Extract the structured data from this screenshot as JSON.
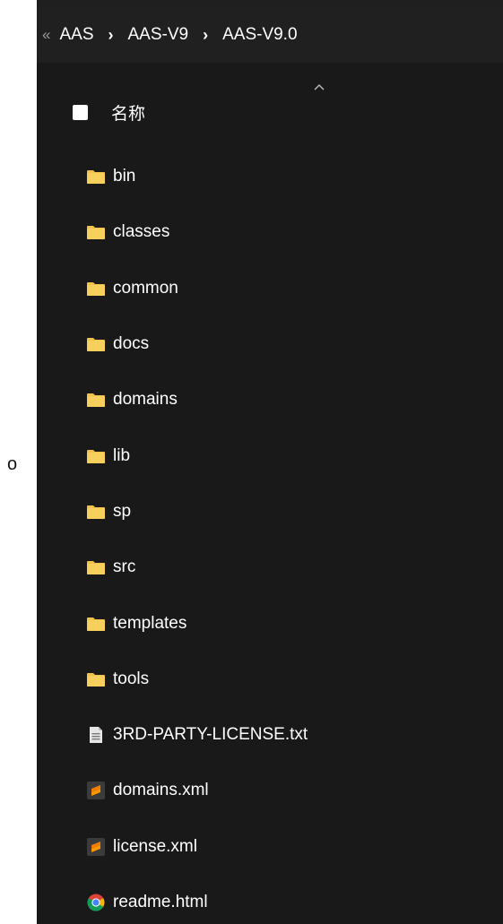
{
  "stray_mark": "o",
  "breadcrumb": {
    "overflow_glyph": "«",
    "separator": "›",
    "items": [
      "AAS",
      "AAS-V9",
      "AAS-V9.0"
    ]
  },
  "column_header": {
    "name_label": "名称",
    "sort_icon": "chevron-up-icon"
  },
  "colors": {
    "background": "#191919",
    "breadcrumb_bar": "#202020",
    "folder": "#f2c14a",
    "sublime_orange": "#f57c00"
  },
  "files": [
    {
      "name": "bin",
      "icon": "folder-icon"
    },
    {
      "name": "classes",
      "icon": "folder-icon"
    },
    {
      "name": "common",
      "icon": "folder-icon"
    },
    {
      "name": "docs",
      "icon": "folder-icon"
    },
    {
      "name": "domains",
      "icon": "folder-icon"
    },
    {
      "name": "lib",
      "icon": "folder-icon"
    },
    {
      "name": "sp",
      "icon": "folder-icon"
    },
    {
      "name": "src",
      "icon": "folder-icon"
    },
    {
      "name": "templates",
      "icon": "folder-icon"
    },
    {
      "name": "tools",
      "icon": "folder-icon"
    },
    {
      "name": "3RD-PARTY-LICENSE.txt",
      "icon": "text-file-icon"
    },
    {
      "name": "domains.xml",
      "icon": "sublime-text-icon"
    },
    {
      "name": "license.xml",
      "icon": "sublime-text-icon"
    },
    {
      "name": "readme.html",
      "icon": "chrome-icon"
    }
  ]
}
